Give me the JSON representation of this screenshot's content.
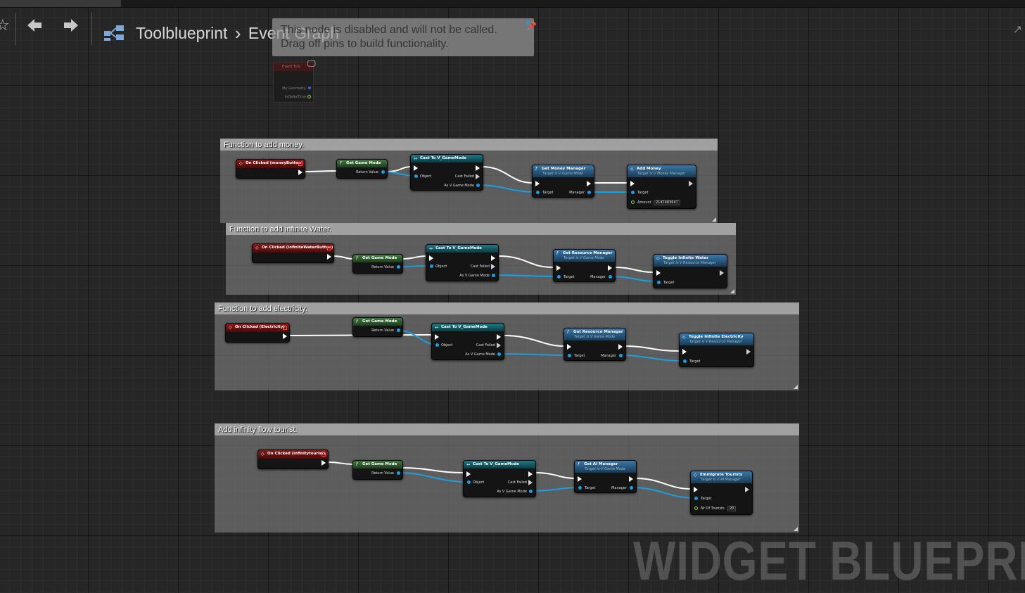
{
  "toolbar": {
    "crumb_root": "Toolblueprint",
    "crumb_sep": "›",
    "crumb_current": "Event Graph"
  },
  "disabled_tooltip": {
    "line1": "This node is disabled and will not be called.",
    "line2": "Drag off pins to build functionality."
  },
  "event_tick": {
    "title": "Event Tick",
    "pin1": "My Geometry",
    "pin2": "InDeltaTime"
  },
  "watermark": "WIDGET BLUEPRINT",
  "comments": [
    "Function to add money.",
    "Function to add infinite Water.",
    "Function to add electricity.",
    "Add infinity flow tourist."
  ],
  "common": {
    "get_game_mode": "Get Game Mode",
    "return_value": "Return Value",
    "cast": "Cast To V_GameMode",
    "object": "Object",
    "cast_failed": "Cast Failed",
    "as_gamemode": "As V Game Mode",
    "target": "Target",
    "manager": "Manager",
    "target_is_gamemode": "Target is V Game Mode"
  },
  "groups": [
    {
      "event": "On Clicked (moneyButton)",
      "getter": "Get Money Manager",
      "action": "Add Money",
      "action_sub": "Target is V Money Manager",
      "extra_label": "Amount",
      "extra_value": "2147483647"
    },
    {
      "event": "On Clicked (infiniteWaterButton)",
      "getter": "Get Resource Manager",
      "action": "Toggle Infinite Water",
      "action_sub": "Target is V Resource Manager"
    },
    {
      "event": "On Clicked (Electricity)",
      "getter": "Get Resource Manager",
      "action": "Toggle Infinite Electricity",
      "action_sub": "Target is V Resource Manager"
    },
    {
      "event": "On Clicked (infinitytourist)",
      "getter": "Get AI Manager",
      "action": "Emmigrate Tourists",
      "action_sub": "Target is V AI Manager",
      "extra_label": "Nr Of Tourists",
      "extra_value": "20"
    }
  ]
}
